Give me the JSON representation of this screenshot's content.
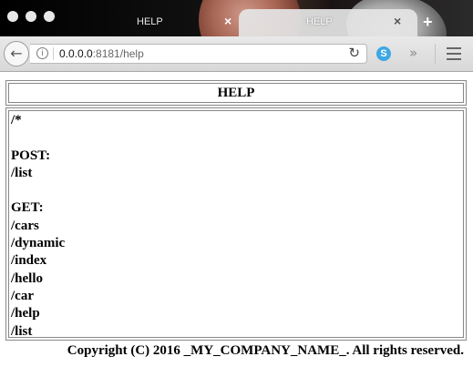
{
  "tabs": [
    {
      "title": "HELP",
      "close": "×"
    },
    {
      "title": "HELP",
      "close": "×"
    }
  ],
  "new_tab_label": "+",
  "address_bar": {
    "host": "0.0.0.0",
    "rest": ":8181/help"
  },
  "page": {
    "heading": "HELP",
    "content": "/*\n\nPOST:\n/list\n\nGET:\n/cars\n/dynamic\n/index\n/hello\n/car\n/help\n/list",
    "footer": "Copyright (C) 2016 _MY_COMPANY_NAME_. All rights reserved."
  },
  "icons": {
    "back": "back-arrow-icon",
    "info": "info-icon",
    "reload": "reload-icon",
    "extension": "skype-extension-icon",
    "overflow": "overflow-chevron-icon",
    "menu": "hamburger-menu-icon"
  }
}
